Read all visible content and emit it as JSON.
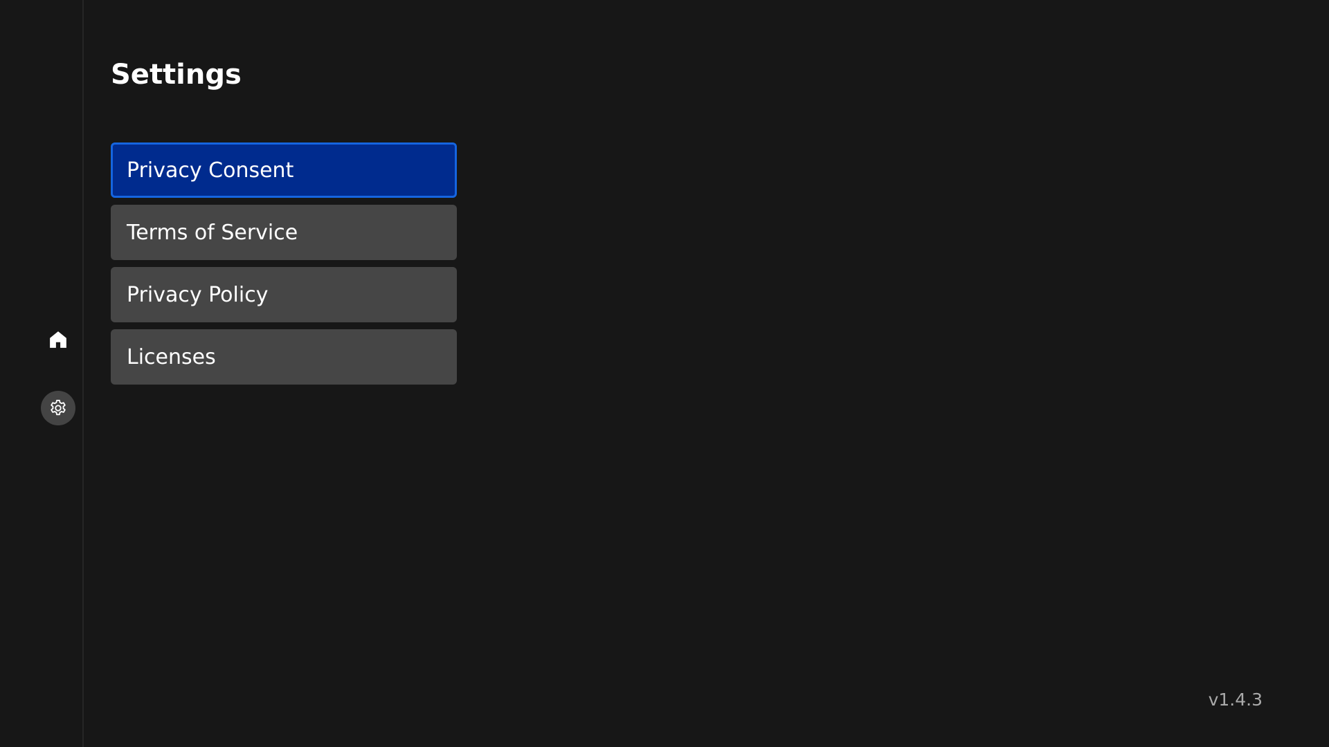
{
  "page": {
    "title": "Settings"
  },
  "nav_rail": {
    "items": [
      {
        "icon": "home-icon",
        "active": false
      },
      {
        "icon": "gear-icon",
        "active": true
      }
    ]
  },
  "settings_menu": {
    "items": [
      {
        "label": "Privacy Consent",
        "selected": true
      },
      {
        "label": "Terms of Service",
        "selected": false
      },
      {
        "label": "Privacy Policy",
        "selected": false
      },
      {
        "label": "Licenses",
        "selected": false
      }
    ]
  },
  "footer": {
    "version": "v1.4.3"
  },
  "colors": {
    "background": "#171717",
    "item_background": "#464646",
    "selected_background": "#002b8e",
    "selected_border": "#1565e0",
    "text": "#ffffff",
    "version_text": "#aaaaaa"
  }
}
